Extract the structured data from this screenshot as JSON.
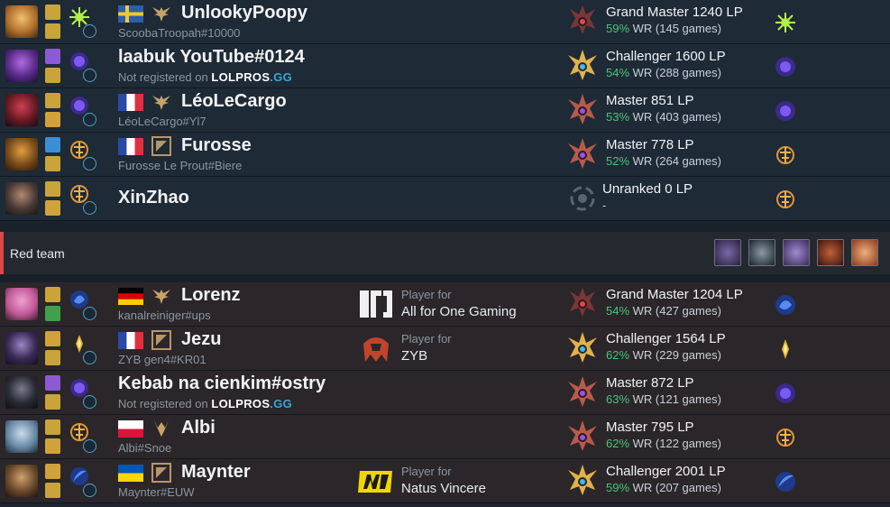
{
  "blue_team": {
    "players": [
      {
        "name": "UnlookyPoopy",
        "tag": "ScoobaTroopah#10000",
        "flag": "se",
        "badge": "wings",
        "team_label": "",
        "team": "",
        "rank": "Grand Master 1240 LP",
        "wr_pct": "59%",
        "wr_rest": "WR (145 games)",
        "champ_color": "#c7923a",
        "rune_color": "#3fa14b",
        "emblem": "gm",
        "spells": [
          "#c9a43a",
          "#3b8fd6"
        ]
      },
      {
        "name": "laabuk YouTube#0124",
        "registered": false,
        "notreg_text": "Not registered on",
        "notreg_brand_a": "LOLPROS",
        "notreg_brand_b": ".GG",
        "flag": "",
        "badge": "",
        "rank": "Challenger 1600 LP",
        "wr_pct": "54%",
        "wr_rest": "WR (288 games)",
        "champ_color": "#5b3a8c",
        "rune_color": "#6a4fd1",
        "emblem": "ch",
        "spells": [
          "#8d5ad6",
          "#c9a43a"
        ]
      },
      {
        "name": "LéoLeCargo",
        "tag": "LéoLeCargo#Yl7",
        "flag": "fr",
        "badge": "wings",
        "rank": "Master 851 LP",
        "wr_pct": "53%",
        "wr_rest": "WR (403 games)",
        "champ_color": "#7a2430",
        "rune_color": "#6a4fd1",
        "emblem": "ma",
        "spells": [
          "#c9a43a",
          "#d1a23a"
        ]
      },
      {
        "name": "Furosse",
        "tag": "Furosse Le Prout#Biere",
        "flag": "fr",
        "badge": "square",
        "rank": "Master 778 LP",
        "wr_pct": "52%",
        "wr_rest": "WR (264 games)",
        "champ_color": "#9a6a2a",
        "rune_color": "#d08a2a",
        "emblem": "ma",
        "spells": [
          "#3b8fd6",
          "#c9a43a"
        ]
      },
      {
        "name": "XinZhao",
        "solo": true,
        "flag": "",
        "badge": "",
        "rank": "Unranked 0 LP",
        "wr_pct": "",
        "wr_rest": "-",
        "champ_color": "#5c4a46",
        "rune_color": "#d08a2a",
        "emblem": "un",
        "spells": [
          "#c9a43a",
          "#d1a23a"
        ]
      }
    ]
  },
  "red_team": {
    "label": "Red team",
    "bans": [
      "#4a3c66",
      "#3c4a52",
      "#6a5a86",
      "#6a2a1e",
      "#c86a3a"
    ],
    "players": [
      {
        "name": "Lorenz",
        "tag": "kanalreiniger#ups",
        "flag": "de",
        "badge": "wings",
        "team_label": "Player for",
        "team": "All for One Gaming",
        "teamlogo": "afo",
        "rank": "Grand Master 1204 LP",
        "wr_pct": "54%",
        "wr_rest": "WR (427 games)",
        "champ_color": "#d46ab0",
        "rune_color": "#3b6fd6",
        "emblem": "gm",
        "spells": [
          "#c9a43a",
          "#3fa14b"
        ]
      },
      {
        "name": "Jezu",
        "tag": "ZYB gen4#KR01",
        "flag": "fr",
        "badge": "square",
        "team_label": "Player for",
        "team": "ZYB",
        "teamlogo": "zyb",
        "rank": "Challenger 1564 LP",
        "wr_pct": "62%",
        "wr_rest": "WR (229 games)",
        "champ_color": "#4a3a66",
        "rune_color": "#c9a43a",
        "emblem": "ch",
        "spells": [
          "#d1a23a",
          "#c9a43a"
        ]
      },
      {
        "name": "Kebab na cienkim#ostry",
        "registered": false,
        "notreg_text": "Not registered on",
        "notreg_brand_a": "LOLPROS",
        "notreg_brand_b": ".GG",
        "flag": "",
        "badge": "",
        "rank": "Master 872 LP",
        "wr_pct": "63%",
        "wr_rest": "WR (121 games)",
        "champ_color": "#3a3a46",
        "rune_color": "#6a4fd1",
        "emblem": "ma",
        "spells": [
          "#8d5ad6",
          "#c9a43a"
        ]
      },
      {
        "name": "Albi",
        "tag": "Albi#Snoe",
        "flag": "pl",
        "badge": "claw",
        "rank": "Master 795 LP",
        "wr_pct": "62%",
        "wr_rest": "WR (122 games)",
        "champ_color": "#8aa6c0",
        "rune_color": "#d08a2a",
        "emblem": "ma",
        "spells": [
          "#c9a43a",
          "#d1a23a"
        ]
      },
      {
        "name": "Maynter",
        "tag": "Maynter#EUW",
        "flag": "ua",
        "badge": "square",
        "team_label": "Player for",
        "team": "Natus Vincere",
        "teamlogo": "navi",
        "rank": "Challenger 2001 LP",
        "wr_pct": "59%",
        "wr_rest": "WR (207 games)",
        "champ_color": "#7a5a3a",
        "rune_color": "#3b6fd6",
        "emblem": "ch",
        "spells": [
          "#d1a23a",
          "#c9a43a"
        ]
      }
    ]
  },
  "colors": {
    "accent_red": "#e04848",
    "wr_green": "#4cc37b",
    "lolpros_blue": "#39a7d6"
  }
}
